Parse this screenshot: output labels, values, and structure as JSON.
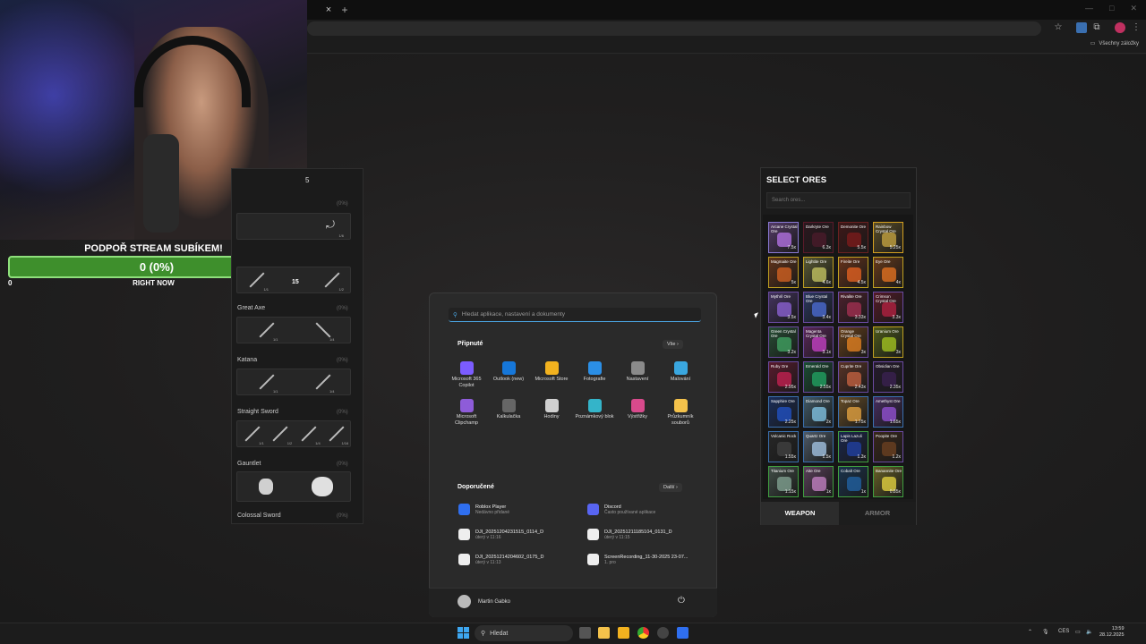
{
  "browser": {
    "tab_close": "×",
    "tab_new": "+",
    "bookmarks_all": "Všechny záložky"
  },
  "overlay": {
    "sub_title": "PODPOŘ STREAM SUBÍKEM!",
    "sub_progress": "0 (0%)",
    "sub_min": "0",
    "sub_label": "RIGHT NOW",
    "sub_progress_fraction": 0
  },
  "weapons_panel": {
    "header": "5",
    "sections": [
      {
        "title": "",
        "pct": "(0%)",
        "counts": [
          "1/6"
        ]
      },
      {
        "title": "",
        "pct": "",
        "counts": [
          "1/1",
          "15",
          "1/2"
        ]
      },
      {
        "title": "Great Axe",
        "pct": "(0%)",
        "counts": [
          "1/1",
          "1/4"
        ]
      },
      {
        "title": "Katana",
        "pct": "(0%)",
        "counts": [
          "1/1",
          "1/4"
        ]
      },
      {
        "title": "Straight Sword",
        "pct": "(0%)",
        "counts": [
          "1/1",
          "1/2",
          "1/4",
          "1/16"
        ]
      },
      {
        "title": "Gauntlet",
        "pct": "(0%)",
        "counts": [
          "",
          ""
        ]
      },
      {
        "title": "Colossal Sword",
        "pct": "(0%)",
        "counts": []
      }
    ]
  },
  "start_menu": {
    "search_placeholder": "Hledat aplikace, nastavení a dokumenty",
    "pinned_label": "Připnuté",
    "all_label": "Vše",
    "pinned": [
      {
        "label": "Microsoft 365 Copilot",
        "color": "#7b5cff"
      },
      {
        "label": "Outlook (new)",
        "color": "#1677d9"
      },
      {
        "label": "Microsoft Store",
        "color": "#f2b21f"
      },
      {
        "label": "Fotografie",
        "color": "#2b8fe6"
      },
      {
        "label": "Nastavení",
        "color": "#8a8a8a"
      },
      {
        "label": "Malování",
        "color": "#3aa7e0"
      },
      {
        "label": "Microsoft Clipchamp",
        "color": "#8e5cd9"
      },
      {
        "label": "Kalkulačka",
        "color": "#666666"
      },
      {
        "label": "Hodiny",
        "color": "#d0d0d0"
      },
      {
        "label": "Poznámkový blok",
        "color": "#34b4c9"
      },
      {
        "label": "Výstřižky",
        "color": "#d84a8c"
      },
      {
        "label": "Průzkumník souborů",
        "color": "#f4c24b"
      }
    ],
    "recommended_label": "Doporučené",
    "more_label": "Další",
    "recommended": [
      {
        "title": "Roblox Player",
        "sub": "Nedávno přidané",
        "color": "#2f6ff0"
      },
      {
        "title": "Discord",
        "sub": "Často používané aplikace",
        "color": "#5865f2"
      },
      {
        "title": "DJI_20251204231515_0114_D",
        "sub": "úterý v 11:16",
        "color": "#eeeeee"
      },
      {
        "title": "DJI_20251211185104_0131_D",
        "sub": "úterý v 11:15",
        "color": "#eeeeee"
      },
      {
        "title": "DJI_20251214204602_0175_D",
        "sub": "úterý v 11:13",
        "color": "#eeeeee"
      },
      {
        "title": "ScreenRecording_11-30-2025 23-07...",
        "sub": "1. pro",
        "color": "#eeeeee"
      }
    ],
    "user": "Martin Gabko",
    "power_icon": "⏻"
  },
  "ores_panel": {
    "title": "SELECT ORES",
    "search_placeholder": "Search ores...",
    "ores": [
      {
        "name": "Arcane Crystal Ore",
        "mult": "7.5x",
        "color": "#b070e0",
        "border": "#8a7ad6"
      },
      {
        "name": "Darkryte Ore",
        "mult": "6.3x",
        "color": "#4a1a2a",
        "border": "#5a1a2a"
      },
      {
        "name": "Demonite Ore",
        "mult": "5.5x",
        "color": "#7a1a1a",
        "border": "#6a2020"
      },
      {
        "name": "Rainbow Crystal Ore",
        "mult": "5.25x",
        "color": "#c0a040",
        "border": "#d4a020"
      },
      {
        "name": "Magmaite Ore",
        "mult": "5x",
        "color": "#d06020",
        "border": "#c0a020"
      },
      {
        "name": "Lightite Ore",
        "mult": "4.6x",
        "color": "#c0c060",
        "border": "#c0a020"
      },
      {
        "name": "Fireite Ore",
        "mult": "4.5x",
        "color": "#e06020",
        "border": "#c0a020"
      },
      {
        "name": "Eye Ore",
        "mult": "4x",
        "color": "#e07020",
        "border": "#c0a020"
      },
      {
        "name": "Mythril Ore",
        "mult": "3.5x",
        "color": "#8a60d0",
        "border": "#6a4aa0"
      },
      {
        "name": "Blue Crystal Ore",
        "mult": "3.4x",
        "color": "#4a6ad0",
        "border": "#6a4aa0"
      },
      {
        "name": "Rivalite Ore",
        "mult": "3.33x",
        "color": "#a03050",
        "border": "#6a4aa0"
      },
      {
        "name": "Crimson Crystal Ore",
        "mult": "3.3x",
        "color": "#b02040",
        "border": "#6a4aa0"
      },
      {
        "name": "Green Crystal Ore",
        "mult": "3.2x",
        "color": "#40a060",
        "border": "#6a4aa0"
      },
      {
        "name": "Magenta Crystal Ore",
        "mult": "3.1x",
        "color": "#c040c0",
        "border": "#6a4aa0"
      },
      {
        "name": "Orange Crystal Ore",
        "mult": "3x",
        "color": "#e08020",
        "border": "#6a4aa0"
      },
      {
        "name": "Uranium Ore",
        "mult": "3x",
        "color": "#a0c020",
        "border": "#c0a020"
      },
      {
        "name": "Ruby Ore",
        "mult": "2.95x",
        "color": "#c02050",
        "border": "#6a4aa0"
      },
      {
        "name": "Emerald Ore",
        "mult": "2.55x",
        "color": "#20a060",
        "border": "#6a4aa0"
      },
      {
        "name": "Cuprite Ore",
        "mult": "2.43x",
        "color": "#c06040",
        "border": "#6a4aa0"
      },
      {
        "name": "Obsidian Ore",
        "mult": "2.35x",
        "color": "#3a2050",
        "border": "#6a4aa0"
      },
      {
        "name": "Sapphire Ore",
        "mult": "2.25x",
        "color": "#2050c0",
        "border": "#3a70b0"
      },
      {
        "name": "Diamond Ore",
        "mult": "2x",
        "color": "#80c0e0",
        "border": "#3a70b0"
      },
      {
        "name": "Topaz Ore",
        "mult": "1.75x",
        "color": "#e0a040",
        "border": "#3a70b0"
      },
      {
        "name": "Amethyst Ore",
        "mult": "1.65x",
        "color": "#9050d0",
        "border": "#3a70b0"
      },
      {
        "name": "Volcanic Rock",
        "mult": "1.55x",
        "color": "#404040",
        "border": "#3a70b0"
      },
      {
        "name": "Quartz Ore",
        "mult": "1.5x",
        "color": "#a0c0e0",
        "border": "#3a70b0"
      },
      {
        "name": "Lapis Lazuli Ore",
        "mult": "1.3x",
        "color": "#2040a0",
        "border": "#40a040"
      },
      {
        "name": "Poopite Ore",
        "mult": "1.2x",
        "color": "#6a4020",
        "border": "#6a4aa0"
      },
      {
        "name": "Titanium Ore",
        "mult": "1.15x",
        "color": "#80a090",
        "border": "#40a040"
      },
      {
        "name": "Aite Ore",
        "mult": "1x",
        "color": "#c080c0",
        "border": "#40a040"
      },
      {
        "name": "Cobalt Ore",
        "mult": "1x",
        "color": "#2060a0",
        "border": "#40a040"
      },
      {
        "name": "Banannite Ore",
        "mult": "0.85x",
        "color": "#e0d040",
        "border": "#40a040"
      }
    ],
    "tab_weapon": "WEAPON",
    "tab_armor": "ARMOR"
  },
  "taskbar": {
    "search_label": "Hledat",
    "language": "CES",
    "time": "13:59",
    "date": "28.12.2025"
  }
}
